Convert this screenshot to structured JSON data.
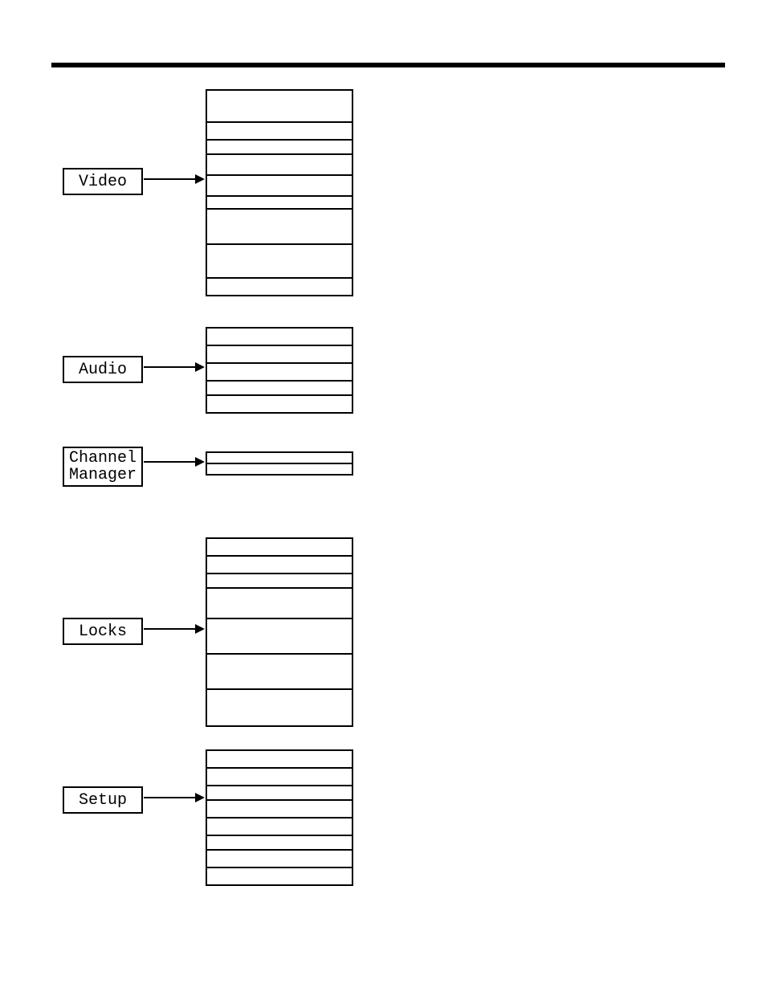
{
  "page_title": "",
  "footer_page": "",
  "menus": {
    "video": "Video",
    "audio": "Audio",
    "channel_manager": "Channel\nManager",
    "locks": "Locks",
    "setup": "Setup"
  },
  "tables": {
    "video_row_heights": [
      38,
      20,
      16,
      24,
      24,
      14,
      42,
      40,
      20
    ],
    "audio_row_heights": [
      20,
      20,
      20,
      16,
      20
    ],
    "channel_row_heights": [
      12,
      12
    ],
    "locks_row_heights": [
      20,
      20,
      16,
      36,
      42,
      42,
      44
    ],
    "setup_row_heights": [
      20,
      20,
      16,
      20,
      20,
      16,
      20,
      20
    ]
  }
}
